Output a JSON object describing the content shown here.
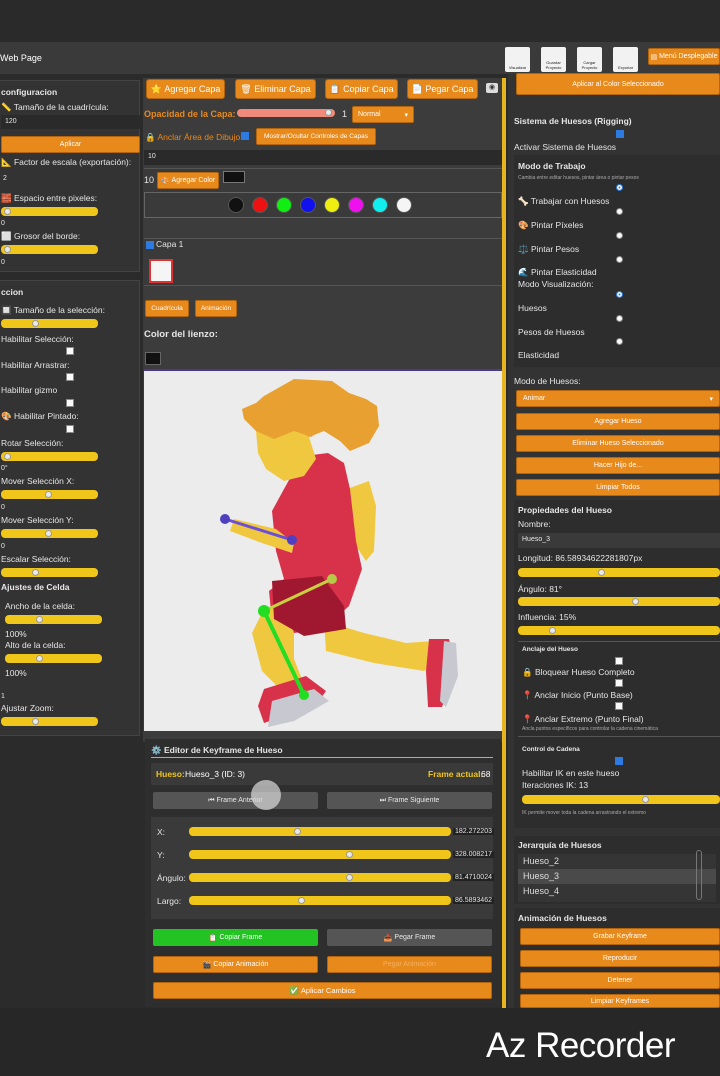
{
  "header": {
    "title": "Web Page",
    "tools": [
      "Visualizar",
      "Guardar Proyecto",
      "Cargar Proyecto",
      "Exportar"
    ],
    "menu": "Menú Desplegable"
  },
  "left": {
    "config_title": "configuracion",
    "grid_size_label": "Tamaño de la cuadrícula:",
    "grid_size_value": "120",
    "apply": "Aplicar",
    "scale_label": "Factor de escala (exportación):",
    "scale_value": "2",
    "pixel_space_label": "Espacio entre pixeles:",
    "pixel_space_value": "0",
    "border_label": "Grosor del borde:",
    "border_value": "0",
    "selection_title": "ccion",
    "sel_size_label": "Tamaño de la selección:",
    "enable_sel": "Habilitar Selección:",
    "enable_drag": "Habilitar Arrastrar:",
    "enable_gizmo": "Habilitar gizmo",
    "enable_paint": "Habilitar Pintado:",
    "rotate_label": "Rotar Selección:",
    "rotate_value": "0°",
    "move_x_label": "Mover Selección X:",
    "move_x_value": "0",
    "move_y_label": "Mover Selección Y:",
    "move_y_value": "0",
    "scale_sel_label": "Escalar Selección:",
    "cell_title": "Ajustes de Celda",
    "cell_w_label": "Ancho de la celda:",
    "cell_w_value": "100%",
    "cell_h_label": "Alto de la celda:",
    "cell_h_value": "100%",
    "zoom_value": "1",
    "zoom_label": "Ajustar Zoom:"
  },
  "center": {
    "add_layer": "Agregar Capa",
    "del_layer": "Eliminar Capa",
    "copy_layer": "Copiar Capa",
    "paste_layer": "Pegar Capa",
    "opacity_label": "Opacidad de la Capa:",
    "opacity_value": "1",
    "blend_mode": "Normal",
    "anchor_label": "Anclar Área de Dibujo:",
    "toggle_controls": "Mostrar/Ocultar Controles de Capas",
    "field_value": "10",
    "color_count": "10",
    "add_color": "Agregar Color",
    "palette": [
      "#111111",
      "#ee1111",
      "#11ee11",
      "#1111ee",
      "#eeee11",
      "#ee11ee",
      "#11eeee",
      "#f5f5f5"
    ],
    "layer_name": "Capa 1",
    "grid_btn": "Cuadrícula",
    "anim_btn": "Animación",
    "canvas_color_label": "Color del lienzo:"
  },
  "kf": {
    "title": "Editor de Keyframe de Hueso",
    "bone_label": "Hueso:",
    "bone_name": "Hueso_3 (ID: 3)",
    "frame_label": "Frame actual:",
    "frame_value": "68",
    "prev": "Frame Anterior",
    "next": "Frame Siguiente",
    "x_label": "X:",
    "x_value": "182.272203",
    "y_label": "Y:",
    "y_value": "328.008217",
    "angle_label": "Ángulo:",
    "angle_value": "81.4710024",
    "length_label": "Largo:",
    "length_value": "86.5893462",
    "copy_frame": "Copiar Frame",
    "paste_frame": "Pegar Frame",
    "copy_anim": "Copiar Animación",
    "paste_anim": "Pegar Animación",
    "apply": "Aplicar Cambios"
  },
  "right": {
    "apply_color": "Aplicar al Color Seleccionado",
    "rig_title": "Sistema de Huesos (Rigging)",
    "rig_enable": "Activar Sistema de Huesos",
    "work_title": "Modo de Trabajo",
    "work_hint": "Cambia entre editar huesos, pintar área o pintar pesos",
    "work_modes": [
      "Trabajar con Huesos",
      "Pintar Píxeles",
      "Pintar Pesos",
      "Pintar Elasticidad"
    ],
    "vis_title": "Modo Visualización:",
    "vis_modes": [
      "Huesos",
      "Pesos de Huesos",
      "Elasticidad"
    ],
    "bone_mode_label": "Modo de Huesos:",
    "bone_mode_value": "Animar",
    "add_bone": "Agregar Hueso",
    "del_bone": "Eliminar Hueso Seleccionado",
    "child": "Hacer Hijo de...",
    "clear": "Limpiar Todos",
    "props_title": "Propiedades del Hueso",
    "name_label": "Nombre:",
    "name_value": "Hueso_3",
    "length_label": "Longitud: 86.58934622281807px",
    "angle_label": "Ángulo: 81°",
    "influence_label": "Influencia: 15%",
    "anchor_title": "Anclaje del Hueso",
    "lock": "Bloquear Hueso Completo",
    "anchor_start": "Anclar Inicio (Punto Base)",
    "anchor_end": "Anclar Extremo (Punto Final)",
    "anchor_hint": "Ancla puntos específicos para controlar la cadena cinemática",
    "chain_title": "Control de Cadena",
    "ik_label": "Habilitar IK en este hueso",
    "ik_iter": "Iteraciones IK: 13",
    "ik_hint": "IK permite mover toda la cadena arrastrando el extremo",
    "hier_title": "Jerarquía de Huesos",
    "hier": [
      "Hueso_2",
      "Hueso_3",
      "Hueso_4"
    ],
    "anim_title": "Animación de Huesos",
    "rec": "Grabar Keyframe",
    "play": "Reproducir",
    "stop": "Detener",
    "clear_kf": "Limpiar Keyframes"
  },
  "watermark": "Az Recorder"
}
